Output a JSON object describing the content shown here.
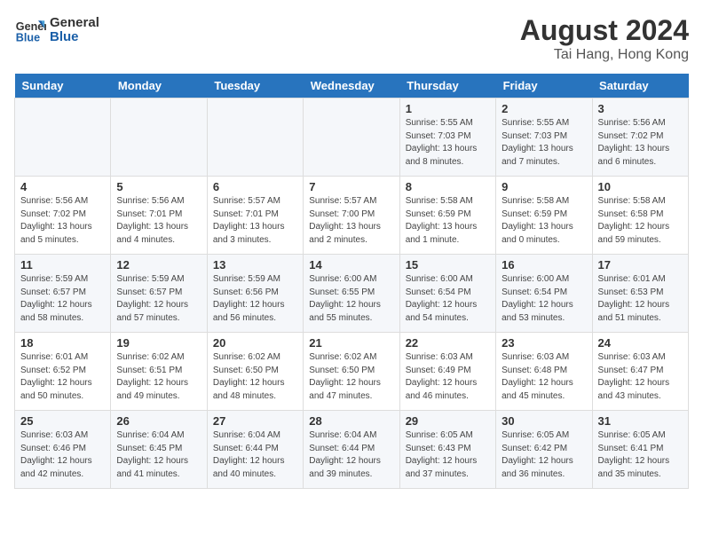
{
  "logo": {
    "line1": "General",
    "line2": "Blue"
  },
  "title": "August 2024",
  "subtitle": "Tai Hang, Hong Kong",
  "days_of_week": [
    "Sunday",
    "Monday",
    "Tuesday",
    "Wednesday",
    "Thursday",
    "Friday",
    "Saturday"
  ],
  "weeks": [
    [
      {
        "day": "",
        "info": ""
      },
      {
        "day": "",
        "info": ""
      },
      {
        "day": "",
        "info": ""
      },
      {
        "day": "",
        "info": ""
      },
      {
        "day": "1",
        "info": "Sunrise: 5:55 AM\nSunset: 7:03 PM\nDaylight: 13 hours\nand 8 minutes."
      },
      {
        "day": "2",
        "info": "Sunrise: 5:55 AM\nSunset: 7:03 PM\nDaylight: 13 hours\nand 7 minutes."
      },
      {
        "day": "3",
        "info": "Sunrise: 5:56 AM\nSunset: 7:02 PM\nDaylight: 13 hours\nand 6 minutes."
      }
    ],
    [
      {
        "day": "4",
        "info": "Sunrise: 5:56 AM\nSunset: 7:02 PM\nDaylight: 13 hours\nand 5 minutes."
      },
      {
        "day": "5",
        "info": "Sunrise: 5:56 AM\nSunset: 7:01 PM\nDaylight: 13 hours\nand 4 minutes."
      },
      {
        "day": "6",
        "info": "Sunrise: 5:57 AM\nSunset: 7:01 PM\nDaylight: 13 hours\nand 3 minutes."
      },
      {
        "day": "7",
        "info": "Sunrise: 5:57 AM\nSunset: 7:00 PM\nDaylight: 13 hours\nand 2 minutes."
      },
      {
        "day": "8",
        "info": "Sunrise: 5:58 AM\nSunset: 6:59 PM\nDaylight: 13 hours\nand 1 minute."
      },
      {
        "day": "9",
        "info": "Sunrise: 5:58 AM\nSunset: 6:59 PM\nDaylight: 13 hours\nand 0 minutes."
      },
      {
        "day": "10",
        "info": "Sunrise: 5:58 AM\nSunset: 6:58 PM\nDaylight: 12 hours\nand 59 minutes."
      }
    ],
    [
      {
        "day": "11",
        "info": "Sunrise: 5:59 AM\nSunset: 6:57 PM\nDaylight: 12 hours\nand 58 minutes."
      },
      {
        "day": "12",
        "info": "Sunrise: 5:59 AM\nSunset: 6:57 PM\nDaylight: 12 hours\nand 57 minutes."
      },
      {
        "day": "13",
        "info": "Sunrise: 5:59 AM\nSunset: 6:56 PM\nDaylight: 12 hours\nand 56 minutes."
      },
      {
        "day": "14",
        "info": "Sunrise: 6:00 AM\nSunset: 6:55 PM\nDaylight: 12 hours\nand 55 minutes."
      },
      {
        "day": "15",
        "info": "Sunrise: 6:00 AM\nSunset: 6:54 PM\nDaylight: 12 hours\nand 54 minutes."
      },
      {
        "day": "16",
        "info": "Sunrise: 6:00 AM\nSunset: 6:54 PM\nDaylight: 12 hours\nand 53 minutes."
      },
      {
        "day": "17",
        "info": "Sunrise: 6:01 AM\nSunset: 6:53 PM\nDaylight: 12 hours\nand 51 minutes."
      }
    ],
    [
      {
        "day": "18",
        "info": "Sunrise: 6:01 AM\nSunset: 6:52 PM\nDaylight: 12 hours\nand 50 minutes."
      },
      {
        "day": "19",
        "info": "Sunrise: 6:02 AM\nSunset: 6:51 PM\nDaylight: 12 hours\nand 49 minutes."
      },
      {
        "day": "20",
        "info": "Sunrise: 6:02 AM\nSunset: 6:50 PM\nDaylight: 12 hours\nand 48 minutes."
      },
      {
        "day": "21",
        "info": "Sunrise: 6:02 AM\nSunset: 6:50 PM\nDaylight: 12 hours\nand 47 minutes."
      },
      {
        "day": "22",
        "info": "Sunrise: 6:03 AM\nSunset: 6:49 PM\nDaylight: 12 hours\nand 46 minutes."
      },
      {
        "day": "23",
        "info": "Sunrise: 6:03 AM\nSunset: 6:48 PM\nDaylight: 12 hours\nand 45 minutes."
      },
      {
        "day": "24",
        "info": "Sunrise: 6:03 AM\nSunset: 6:47 PM\nDaylight: 12 hours\nand 43 minutes."
      }
    ],
    [
      {
        "day": "25",
        "info": "Sunrise: 6:03 AM\nSunset: 6:46 PM\nDaylight: 12 hours\nand 42 minutes."
      },
      {
        "day": "26",
        "info": "Sunrise: 6:04 AM\nSunset: 6:45 PM\nDaylight: 12 hours\nand 41 minutes."
      },
      {
        "day": "27",
        "info": "Sunrise: 6:04 AM\nSunset: 6:44 PM\nDaylight: 12 hours\nand 40 minutes."
      },
      {
        "day": "28",
        "info": "Sunrise: 6:04 AM\nSunset: 6:44 PM\nDaylight: 12 hours\nand 39 minutes."
      },
      {
        "day": "29",
        "info": "Sunrise: 6:05 AM\nSunset: 6:43 PM\nDaylight: 12 hours\nand 37 minutes."
      },
      {
        "day": "30",
        "info": "Sunrise: 6:05 AM\nSunset: 6:42 PM\nDaylight: 12 hours\nand 36 minutes."
      },
      {
        "day": "31",
        "info": "Sunrise: 6:05 AM\nSunset: 6:41 PM\nDaylight: 12 hours\nand 35 minutes."
      }
    ]
  ],
  "colors": {
    "header_bg": "#2874be",
    "header_text": "#ffffff",
    "odd_row_bg": "#f5f7fa",
    "even_row_bg": "#ffffff"
  }
}
